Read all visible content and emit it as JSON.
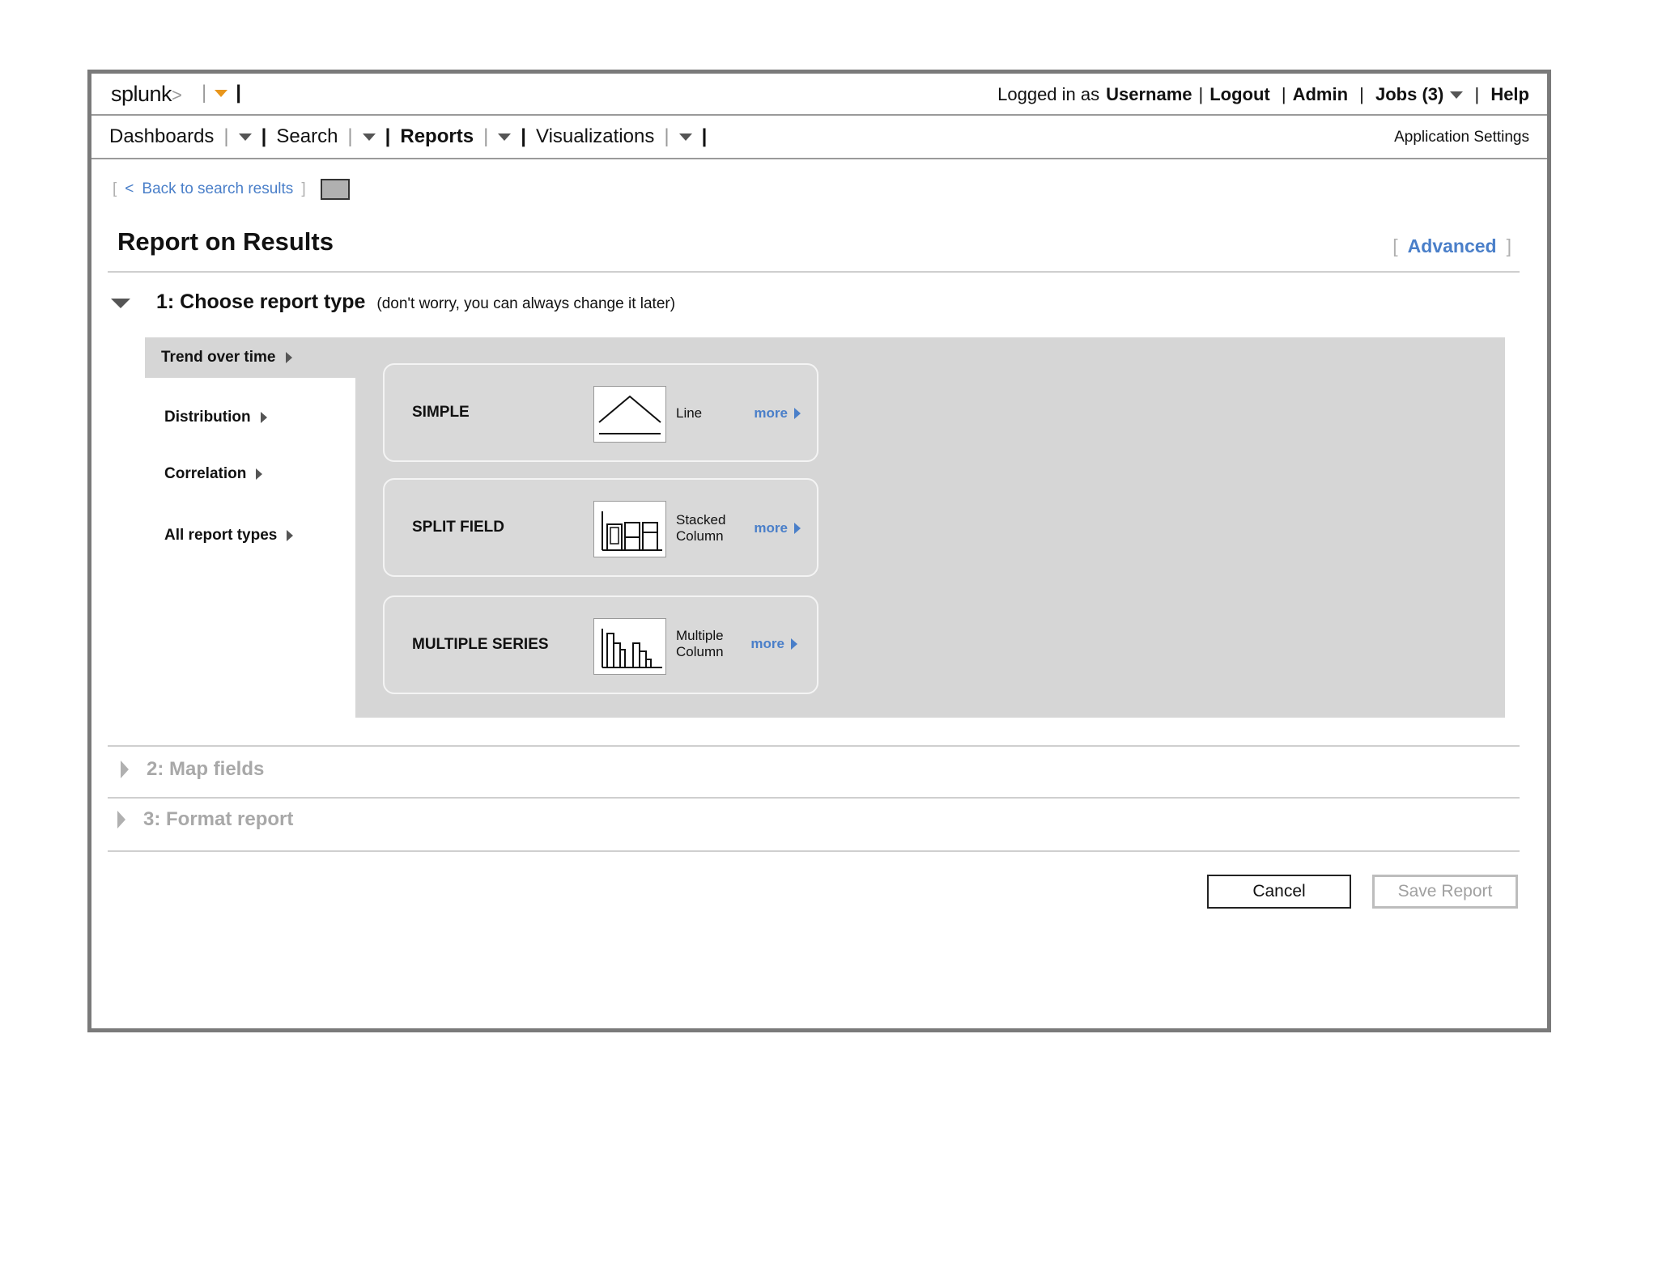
{
  "header": {
    "logo": "splunk",
    "logo_chevron": ">",
    "logged_in_prefix": "Logged in as",
    "username": "Username",
    "logout": "Logout",
    "admin": "Admin",
    "jobs": "Jobs (3)",
    "help": "Help"
  },
  "nav": {
    "dashboards": "Dashboards",
    "search": "Search",
    "reports": "Reports",
    "visualizations": "Visualizations",
    "app_settings": "Application Settings"
  },
  "back": {
    "label": "Back to search results",
    "chevron": "<"
  },
  "page": {
    "title": "Report on Results",
    "advanced": "Advanced"
  },
  "step1": {
    "title": "1: Choose report type",
    "hint": "(don't worry, you can always change it later)"
  },
  "sidebar": {
    "items": [
      {
        "label": "Trend over time",
        "selected": true
      },
      {
        "label": "Distribution"
      },
      {
        "label": "Correlation"
      },
      {
        "label": "All report types"
      }
    ]
  },
  "cards": [
    {
      "label": "SIMPLE",
      "type_line1": "Line",
      "type_line2": "",
      "more": "more",
      "icon": "line-chart-icon"
    },
    {
      "label": "SPLIT FIELD",
      "type_line1": "Stacked",
      "type_line2": "Column",
      "more": "more",
      "icon": "stacked-column-chart-icon"
    },
    {
      "label": "MULTIPLE SERIES",
      "type_line1": "Multiple",
      "type_line2": "Column",
      "more": "more",
      "icon": "multiple-column-chart-icon"
    }
  ],
  "step2": {
    "title": "2: Map fields"
  },
  "step3": {
    "title": "3: Format report"
  },
  "buttons": {
    "cancel": "Cancel",
    "save": "Save Report"
  },
  "colors": {
    "link_blue": "#4a7fc9",
    "accent_orange": "#e8961c",
    "panel_gray": "#d6d6d6",
    "frame_gray": "#7a7a7a"
  }
}
